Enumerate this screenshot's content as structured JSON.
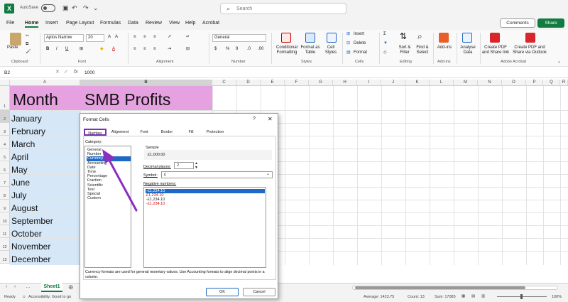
{
  "titlebar": {
    "autosave_label": "AutoSave",
    "search_placeholder": "Search"
  },
  "menu": [
    "File",
    "Home",
    "Insert",
    "Page Layout",
    "Formulas",
    "Data",
    "Review",
    "View",
    "Help",
    "Acrobat"
  ],
  "menu_active": "Home",
  "buttons": {
    "comments": "Comments",
    "share": "Share"
  },
  "ribbon": {
    "paste": "Paste",
    "font_name": "Aptos Narrow",
    "font_size": "20",
    "number_format": "General",
    "conditional_formatting": "Conditional Formatting",
    "format_as_table": "Format as Table",
    "cell_styles": "Cell Styles",
    "insert": "Insert",
    "delete": "Delete",
    "format": "Format",
    "sort_filter": "Sort & Filter",
    "find_select": "Find & Select",
    "addins": "Add-ins",
    "analyse_data": "Analyse Data",
    "create_pdf_share": "Create PDF and Share link",
    "create_pdf_outlook": "Create PDF and Share via Outlook",
    "groups": [
      "Clipboard",
      "Font",
      "Alignment",
      "Number",
      "Styles",
      "Cells",
      "Editing",
      "Add-ins",
      "Adobe Acrobat"
    ]
  },
  "formula_bar": {
    "namebox": "B2",
    "fx": "fx",
    "value": "1000"
  },
  "columns": [
    "A",
    "B",
    "C",
    "D",
    "E",
    "F",
    "G",
    "H",
    "I",
    "J",
    "K",
    "L",
    "M",
    "N",
    "O",
    "P",
    "Q",
    "R"
  ],
  "rows": [
    "1",
    "2",
    "3",
    "4",
    "5",
    "6",
    "7",
    "8",
    "9",
    "10",
    "11",
    "12",
    "13"
  ],
  "sheet": {
    "header_month": "Month",
    "header_profits": "SMB Profits",
    "months": [
      "January",
      "February",
      "March",
      "April",
      "May",
      "June",
      "July",
      "August",
      "September",
      "October",
      "November",
      "December"
    ]
  },
  "dialog": {
    "title": "Format Cells",
    "help": "?",
    "close": "✕",
    "tabs": [
      "Number",
      "Alignment",
      "Font",
      "Border",
      "Fill",
      "Protection"
    ],
    "category_label": "Category:",
    "categories": [
      "General",
      "Number",
      "Currency",
      "Accounting",
      "Date",
      "Time",
      "Percentage",
      "Fraction",
      "Scientific",
      "Text",
      "Special",
      "Custom"
    ],
    "selected_category": "Currency",
    "sample_label": "Sample",
    "sample_value": "£1,000.00",
    "decimal_label": "Decimal places:",
    "decimal_value": "2",
    "symbol_label": "Symbol:",
    "symbol_value": "£",
    "negative_label": "Negative numbers:",
    "negative_options": [
      "-£1,234.10",
      "£1,234.10",
      "-£1,234.10",
      "-£1,234.10"
    ],
    "description": "Currency formats are used for general monetary values.  Use Accounting formats to align decimal points in a column.",
    "ok": "OK",
    "cancel": "Cancel"
  },
  "sheet_tab": "Sheet1",
  "status": {
    "ready": "Ready",
    "accessibility": "Accessibility: Good to go",
    "average": "Average: 1423.75",
    "count": "Count: 13",
    "sum": "Sum: 17085",
    "zoom": "100%"
  },
  "colors": {
    "accent": "#107c41",
    "header_fill": "#e6a1e0",
    "column_fill": "#d6e7f7",
    "highlight": "#7b2fb5",
    "selection": "#2068c5"
  }
}
